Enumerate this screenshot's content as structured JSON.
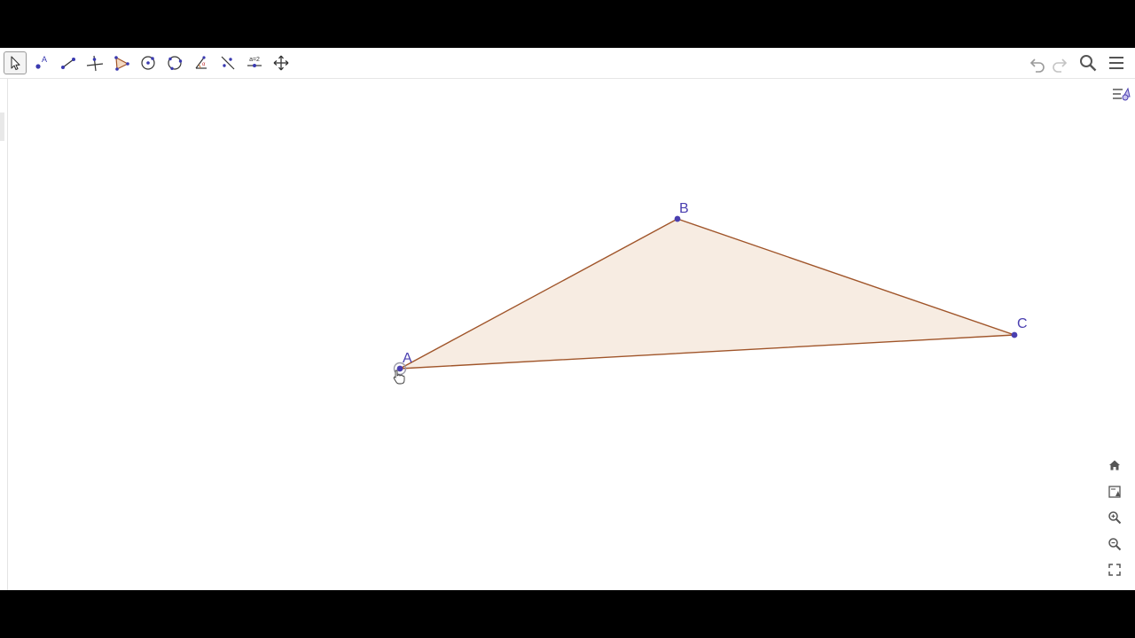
{
  "app": {
    "toolbar": {
      "tools": [
        {
          "name": "move-tool",
          "icon": "pointer-arrow-icon",
          "active": true
        },
        {
          "name": "point-tool",
          "icon": "point-icon",
          "active": false
        },
        {
          "name": "segment-tool",
          "icon": "segment-icon",
          "active": false
        },
        {
          "name": "perpendicular-line-tool",
          "icon": "perpendicular-line-icon",
          "active": false
        },
        {
          "name": "polygon-tool",
          "icon": "polygon-icon",
          "active": false
        },
        {
          "name": "circle-center-point-tool",
          "icon": "circle-center-point-icon",
          "active": false
        },
        {
          "name": "circle-three-points-tool",
          "icon": "circle-three-points-icon",
          "active": false
        },
        {
          "name": "angle-tool",
          "icon": "angle-icon",
          "active": false
        },
        {
          "name": "reflect-tool",
          "icon": "reflect-about-line-icon",
          "active": false
        },
        {
          "name": "slider-tool",
          "icon": "slider-icon",
          "active": false
        },
        {
          "name": "move-graphics-view-tool",
          "icon": "move-graphics-view-icon",
          "active": false
        }
      ],
      "slider_tool_text": "a=2",
      "right_buttons": [
        "undo-icon",
        "redo-icon",
        "search-icon",
        "menu-icon"
      ]
    },
    "colors": {
      "point": "#4a3fb0",
      "polygon_edge": "#a0552a",
      "polygon_fill": "#f7ece2",
      "label": "#4a3fb0"
    },
    "construction": {
      "points": [
        {
          "label": "A"
        },
        {
          "label": "B"
        },
        {
          "label": "C"
        }
      ],
      "selected_point": "A"
    },
    "view_controls": [
      "home-icon",
      "graphics-settings-icon",
      "zoom-in-icon",
      "zoom-out-icon",
      "fullscreen-icon"
    ]
  }
}
